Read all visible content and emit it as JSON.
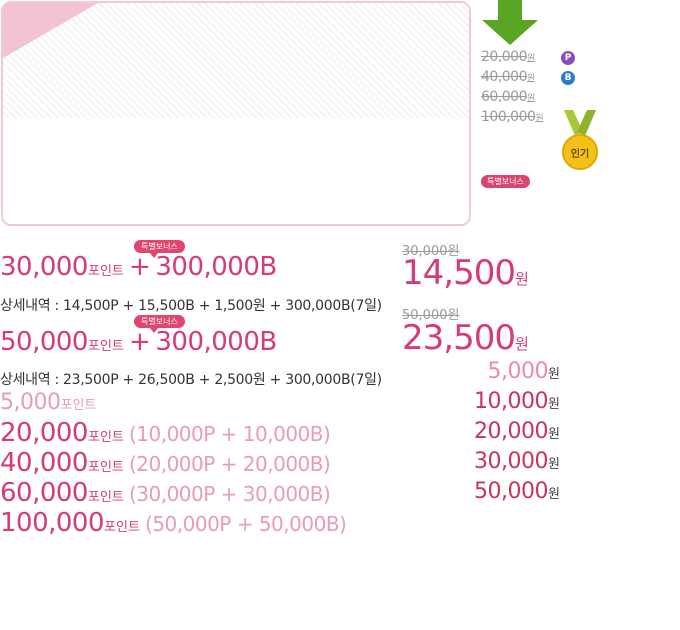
{
  "side": {
    "tiers": [
      {
        "amount": "20,000",
        "unit": "원",
        "badge": "P",
        "badge_color": "#8d4bbd"
      },
      {
        "amount": "40,000",
        "unit": "원",
        "badge": "B",
        "badge_color": "#2a7fc4"
      },
      {
        "amount": "60,000",
        "unit": "원"
      },
      {
        "amount": "100,000",
        "unit": "원"
      }
    ],
    "medal_label": "인기",
    "special_bonus": "특별보너스",
    "arrow_color": "#5aa624"
  },
  "offers": [
    {
      "tag": "특별보너스",
      "points": "30,000",
      "points_unit": "포인트",
      "plus": "+",
      "bonus": "300,000B",
      "detail": "상세내역 : 14,500P + 15,500B + 1,500원 + 300,000B(7일)",
      "old_price": "30,000원",
      "price": "14,500",
      "price_unit": "원"
    },
    {
      "tag": "특별보너스",
      "points": "50,000",
      "points_unit": "포인트",
      "plus": "+",
      "bonus": "300,000B",
      "detail": "상세내역 : 23,500P + 26,500B + 2,500원 + 300,000B(7일)",
      "old_price": "50,000원",
      "price": "23,500",
      "price_unit": "원"
    }
  ],
  "packages": [
    {
      "points": "5,000",
      "unit": "포인트",
      "breakdown": "",
      "price": "5,000",
      "price_unit": "원"
    },
    {
      "points": "20,000",
      "unit": "포인트",
      "breakdown": "(10,000P + 10,000B)",
      "price": "10,000",
      "price_unit": "원"
    },
    {
      "points": "40,000",
      "unit": "포인트",
      "breakdown": "(20,000P + 20,000B)",
      "price": "20,000",
      "price_unit": "원"
    },
    {
      "points": "60,000",
      "unit": "포인트",
      "breakdown": "(30,000P + 30,000B)",
      "price": "30,000",
      "price_unit": "원"
    },
    {
      "points": "100,000",
      "unit": "포인트",
      "breakdown": "(50,000P + 50,000B)",
      "price": "50,000",
      "price_unit": "원"
    }
  ]
}
